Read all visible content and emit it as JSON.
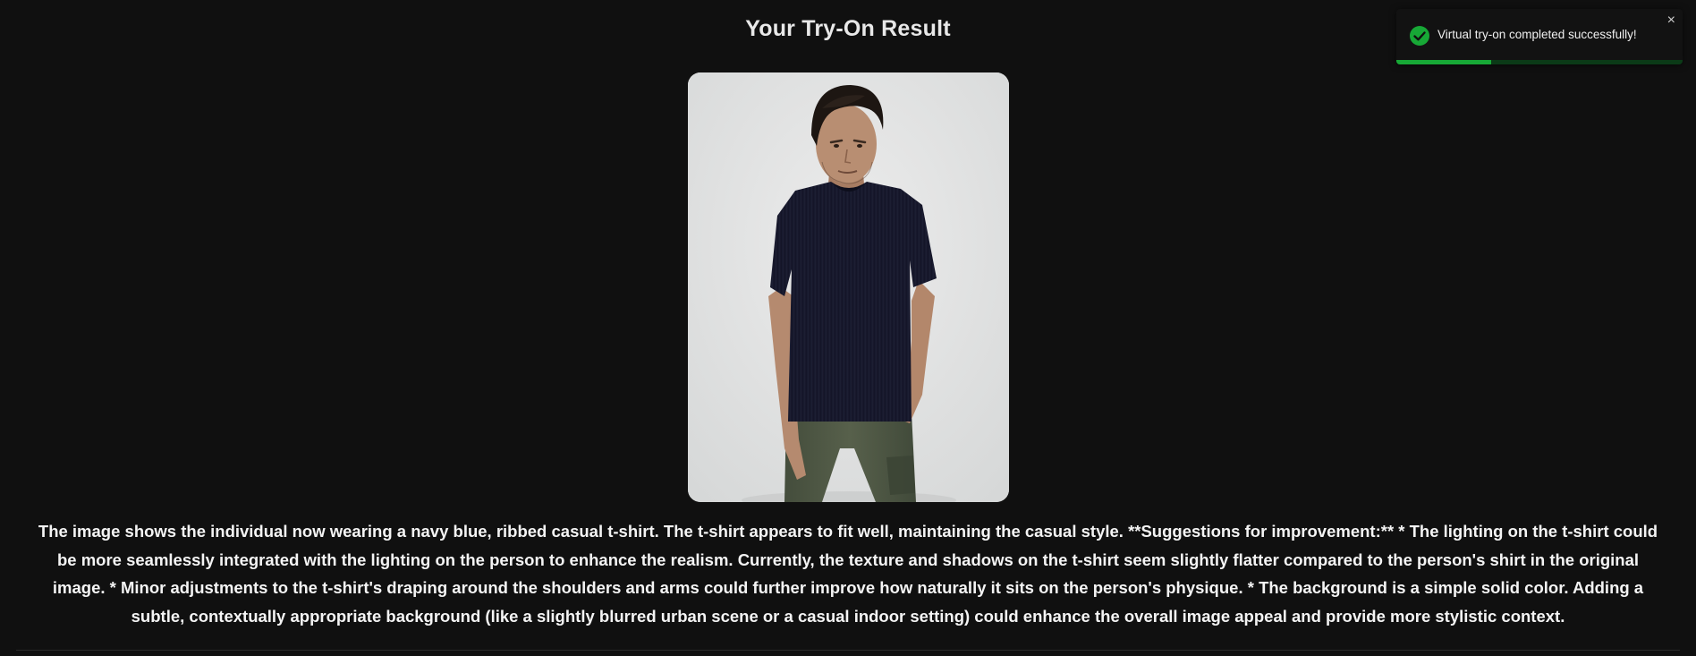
{
  "result": {
    "title": "Your Try-On Result",
    "image_alt": "Try-on result image: person wearing a navy blue ribbed t-shirt and olive cargo pants",
    "description": "The image shows the individual now wearing a navy blue, ribbed casual t-shirt. The t-shirt appears to fit well, maintaining the casual style. **Suggestions for improvement:** * The lighting on the t-shirt could be more seamlessly integrated with the lighting on the person to enhance the realism. Currently, the texture and shadows on the t-shirt seem slightly flatter compared to the person's shirt in the original image. * Minor adjustments to the t-shirt's draping around the shoulders and arms could further improve how naturally it sits on the person's physique. * The background is a simple solid color. Adding a subtle, contextually appropriate background (like a slightly blurred urban scene or a casual indoor setting) could enhance the overall image appeal and provide more stylistic context."
  },
  "toast": {
    "message": "Virtual try-on completed successfully!",
    "close_symbol": "×",
    "icon": "check-circle-icon",
    "progress": 0.33,
    "colors": {
      "success": "#17a836",
      "track": "#0b3a17"
    }
  },
  "colors": {
    "background": "#101010",
    "text": "#f4f4f4"
  }
}
